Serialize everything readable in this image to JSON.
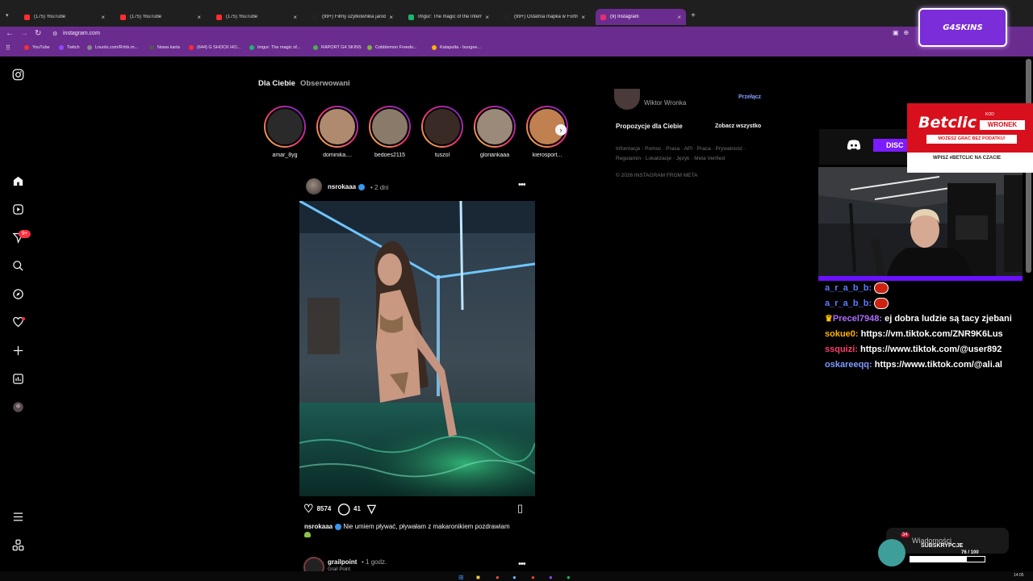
{
  "tabs": [
    {
      "title": "(175) YouTube",
      "fav": "#ff2d2d"
    },
    {
      "title": "(175) YouTube",
      "fav": "#ff2d2d"
    },
    {
      "title": "(175) YouTube",
      "fav": "#ff2d2d"
    },
    {
      "title": "(99+) Filmy użytkownika jarodz",
      "fav": "#222222"
    },
    {
      "title": "Imgur: The magic of the Interne",
      "fav": "#1bb76e"
    },
    {
      "title": "(99+) Ostatnia mapka w Fortnit",
      "fav": "#222222"
    },
    {
      "title": "(9) Instagram",
      "fav": "#e1306c"
    }
  ],
  "address": {
    "url": "instagram.com"
  },
  "bookmarks": [
    {
      "label": "YouTube",
      "color": "#ff2d2d"
    },
    {
      "label": "Twitch",
      "color": "#9146ff"
    },
    {
      "label": "Lnuols.com/Rrhlx.m...",
      "color": "#888888"
    },
    {
      "label": "Nowa karta",
      "color": "#555555"
    },
    {
      "label": "(644) G SHOCK HO...",
      "color": "#ff2d2d"
    },
    {
      "label": "Imgur: The magic of...",
      "color": "#1bb76e"
    },
    {
      "label": "RAPORT G4 SKINS",
      "color": "#4caf50"
    },
    {
      "label": "Cobblemon Freedo...",
      "color": "#7cb342"
    },
    {
      "label": "Katapulta - bungee...",
      "color": "#ffb300"
    }
  ],
  "sponsor": {
    "g4_label": "G4SKINS"
  },
  "feed": {
    "tab_for_you": "Dla Ciebie",
    "tab_following": "Obserwowani",
    "stories": [
      "amar_8yg",
      "dominika....",
      "bedoes2115",
      "tuszol",
      "gloriankaaa",
      "kierosport..."
    ],
    "post": {
      "username": "nsrokaaa",
      "time": "2 dni",
      "likes": "8574",
      "comments": "41",
      "caption_user": "nsrokaaa",
      "caption_text": "Nie umiem pływać, pływałam z makaronikiem pozdrawiam"
    },
    "next_post": {
      "username": "grailpoint",
      "time": "1 godz.",
      "subtitle": "Grail Point"
    }
  },
  "right": {
    "account_name": "Wiktor Wronka",
    "switch_label": "Przełącz",
    "suggestions_title": "Propozycje dla Ciebie",
    "see_all": "Zobacz wszystko",
    "footer_links": "Informacje · Pomoc · Prasa · API · Praca · Prywatność · Regulamin · Lokalizacje · Język · Meta Verified",
    "copyright": "© 2026 INSTAGRAM FROM META"
  },
  "overlay": {
    "discord_label": "DISC",
    "betclic": {
      "logo": "Betclic",
      "kod_label": "KOD",
      "code": "WRONEK",
      "tagline": "MOŻESZ GRAĆ BEZ PODATKU!",
      "footer": "WPISZ #BETCLIC NA CZACIE"
    },
    "chat": [
      {
        "user": "a_r_a_b_b",
        "text": "",
        "cls": "u1",
        "emote": true
      },
      {
        "user": "a_r_a_b_b",
        "text": "",
        "cls": "u1",
        "emote": true
      },
      {
        "user": "Precel7948",
        "text": "ej dobra ludzie są tacy zjebani",
        "cls": "u2",
        "emote": false
      },
      {
        "user": "sokue0",
        "text": "https://vm.tiktok.com/ZNR9K6Lus",
        "cls": "u3",
        "emote": false
      },
      {
        "user": "ssquizi",
        "text": "https://www.tiktok.com/@user892",
        "cls": "u4",
        "emote": false
      },
      {
        "user": "oskareeqq",
        "text": "https://www.tiktok.com/@ali.al",
        "cls": "u5",
        "emote": false
      }
    ],
    "messages_label": "Wiadomości",
    "sub_label": "SUBSKRYPCJE",
    "sub_count": "76 / 100",
    "sub_progress": 0.76,
    "frog_badge": "34"
  },
  "taskbar": {
    "clock": "14:05"
  }
}
